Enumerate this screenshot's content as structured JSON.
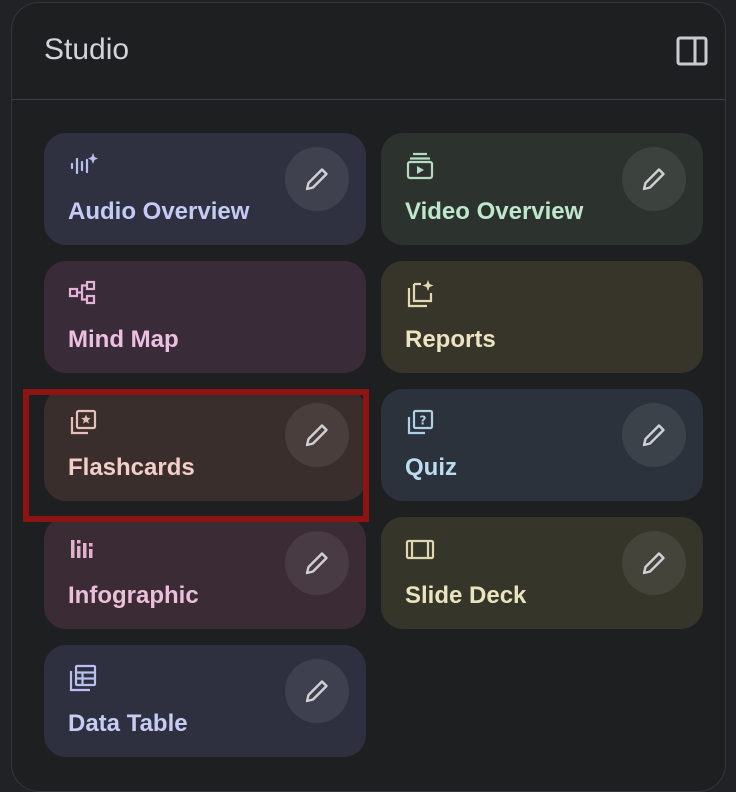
{
  "panel": {
    "title": "Studio",
    "collapse_icon": "side-panel-icon"
  },
  "cards": [
    {
      "label": "Audio Overview",
      "icon": "audio-waveform-sparkle-icon",
      "has_edit": true,
      "bg": "#2f3140",
      "fg": "#c5cbf5",
      "icon_color": "#b9c0ee"
    },
    {
      "label": "Video Overview",
      "icon": "video-stack-icon",
      "has_edit": true,
      "bg": "#2c332f",
      "fg": "#bfe7cc",
      "icon_color": "#b5dbc1"
    },
    {
      "label": "Mind Map",
      "icon": "mind-map-icon",
      "has_edit": false,
      "bg": "#3a2b38",
      "fg": "#ecc0e2",
      "icon_color": "#e3b3d8"
    },
    {
      "label": "Reports",
      "icon": "report-sparkle-icon",
      "has_edit": false,
      "bg": "#37352a",
      "fg": "#ece3c0",
      "icon_color": "#e2d9b2"
    },
    {
      "label": "Flashcards",
      "icon": "flashcards-icon",
      "has_edit": true,
      "bg": "#3a2e2c",
      "fg": "#f2cfc8",
      "icon_color": "#e6c0b8"
    },
    {
      "label": "Quiz",
      "icon": "quiz-question-icon",
      "has_edit": true,
      "bg": "#2b323b",
      "fg": "#bcdcef",
      "icon_color": "#b0d0e6"
    },
    {
      "label": "Infographic",
      "icon": "infographic-bars-icon",
      "has_edit": true,
      "bg": "#3a2b35",
      "fg": "#ecbfd9",
      "icon_color": "#e0b2cd"
    },
    {
      "label": "Slide Deck",
      "icon": "slide-deck-icon",
      "has_edit": true,
      "bg": "#35352a",
      "fg": "#e9e4bd",
      "icon_color": "#ddd8b0"
    },
    {
      "label": "Data Table",
      "icon": "data-table-icon",
      "has_edit": true,
      "bg": "#2e3040",
      "fg": "#c6ccf2",
      "icon_color": "#b9c0ec"
    }
  ],
  "edit_icon": "pencil-icon",
  "highlight_color": "#8e1414"
}
